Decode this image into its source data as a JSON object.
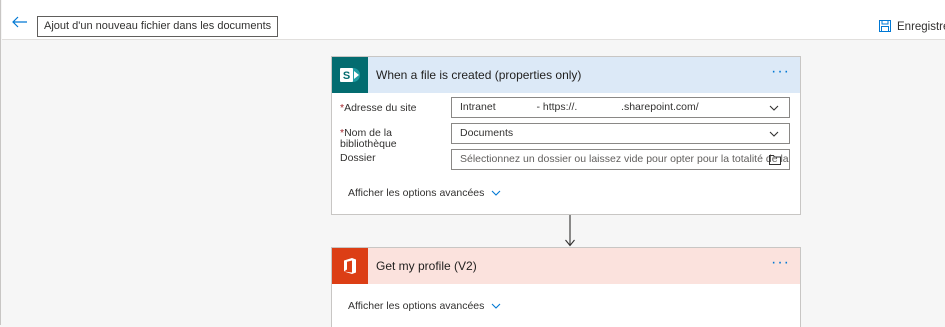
{
  "header": {
    "flow_title": "Ajout d'un nouveau fichier dans les documents",
    "save_label": "Enregistre"
  },
  "trigger": {
    "title": "When a file is created (properties only)",
    "fields": [
      {
        "label": "Adresse du site",
        "required": true,
        "value": "Intranet              - https://.               .sharepoint.com/"
      },
      {
        "label": "Nom de la bibliothèque",
        "required": true,
        "value": "Documents"
      },
      {
        "label": "Dossier",
        "required": false,
        "placeholder": "Sélectionnez un dossier ou laissez vide pour opter pour la totalité de la"
      }
    ],
    "advanced_label": "Afficher les options avancées"
  },
  "action": {
    "title": "Get my profile (V2)",
    "advanced_label": "Afficher les options avancées"
  },
  "colors": {
    "accent": "#0078d4",
    "sharepoint_header": "#dce9f7",
    "office_header": "#fbe2dd",
    "sharepoint_logo": "#036c70",
    "office_logo": "#dc3e15",
    "required": "#a4262c"
  }
}
